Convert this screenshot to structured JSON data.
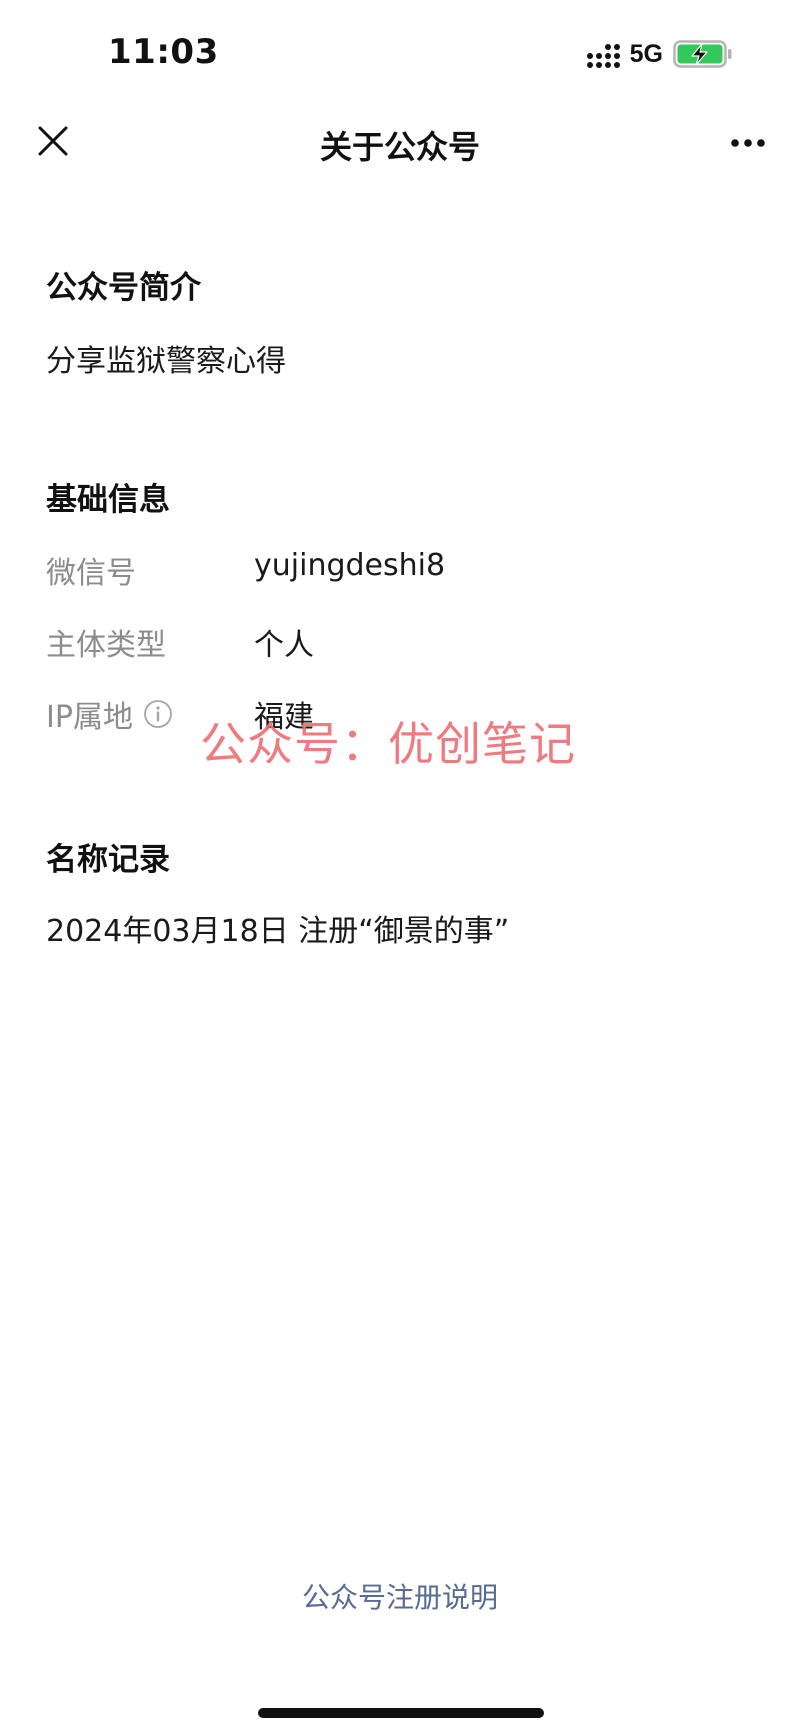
{
  "status_bar": {
    "time": "11:03",
    "network": "5G",
    "battery_color": "#34c759"
  },
  "nav": {
    "title": "关于公众号",
    "close_icon": "close-icon",
    "more_icon": "more-icon"
  },
  "intro": {
    "title": "公众号简介",
    "text": "分享监狱警察心得"
  },
  "basic_info": {
    "title": "基础信息",
    "rows": [
      {
        "label": "微信号",
        "value": "yujingdeshi8"
      },
      {
        "label": "主体类型",
        "value": "个人"
      },
      {
        "label": "IP属地",
        "value": "福建"
      }
    ]
  },
  "name_history": {
    "title": "名称记录",
    "entries": [
      "2024年03月18日 注册“御景的事”"
    ]
  },
  "watermark": {
    "text": "公众号：优创笔记",
    "color": "#ee6f76"
  },
  "footer": {
    "link": "公众号注册说明",
    "link_color": "#576b95"
  }
}
